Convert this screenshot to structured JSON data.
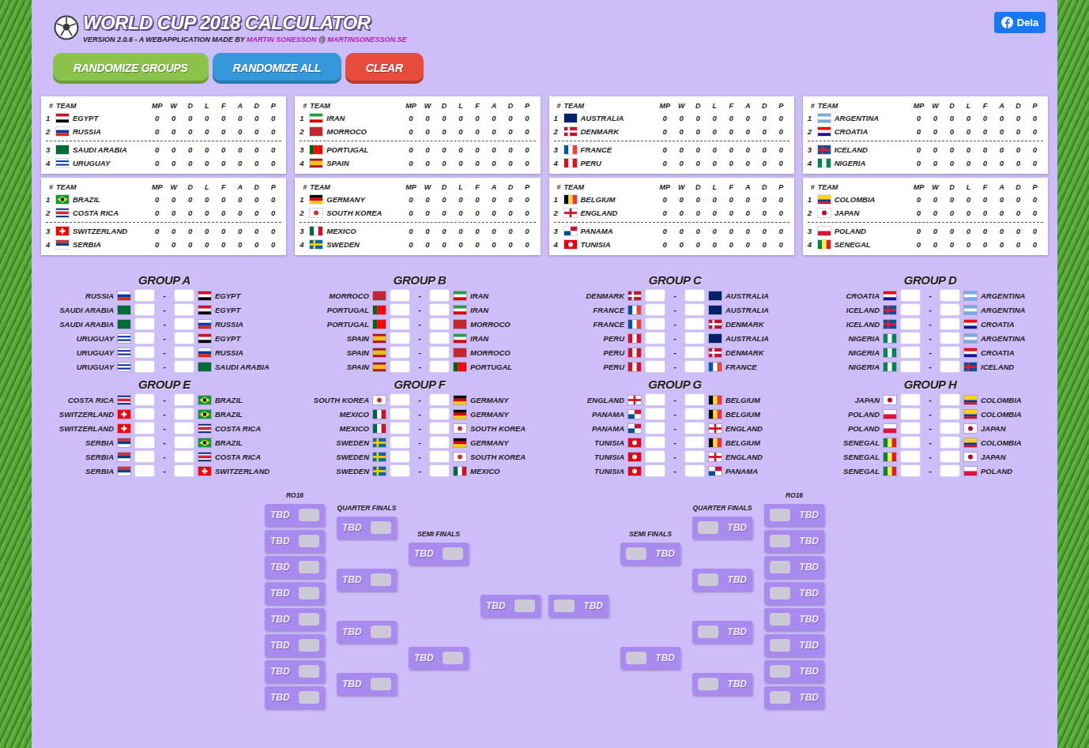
{
  "header": {
    "title": "WORLD CUP 2018 CALCULATOR",
    "version": "VERSION 2.0.6 - A WEBAPPLICATION MADE BY",
    "author": "MARTIN SONESSON",
    "at": "@",
    "site": "MARTINSONESSON.SE"
  },
  "share": {
    "label": "Dela"
  },
  "buttons": [
    {
      "label": "RANDOMIZE GROUPS",
      "color": "#8bc34a"
    },
    {
      "label": "RANDOMIZE ALL",
      "color": "#3498db"
    },
    {
      "label": "CLEAR",
      "color": "#e74c3c"
    }
  ],
  "tableColumns": [
    "#",
    "TEAM",
    "MP",
    "W",
    "D",
    "L",
    "F",
    "A",
    "D",
    "P"
  ],
  "tables": [
    {
      "rows": [
        {
          "pos": "1",
          "team": "EGYPT",
          "stats": [
            "0",
            "0",
            "0",
            "0",
            "0",
            "0",
            "0",
            "0"
          ]
        },
        {
          "pos": "2",
          "team": "RUSSIA",
          "stats": [
            "0",
            "0",
            "0",
            "0",
            "0",
            "0",
            "0",
            "0"
          ]
        },
        {
          "pos": "3",
          "team": "SAUDI ARABIA",
          "stats": [
            "0",
            "0",
            "0",
            "0",
            "0",
            "0",
            "0",
            "0"
          ]
        },
        {
          "pos": "4",
          "team": "URUGUAY",
          "stats": [
            "0",
            "0",
            "0",
            "0",
            "0",
            "0",
            "0",
            "0"
          ]
        }
      ]
    },
    {
      "rows": [
        {
          "pos": "1",
          "team": "IRAN",
          "stats": [
            "0",
            "0",
            "0",
            "0",
            "0",
            "0",
            "0",
            "0"
          ]
        },
        {
          "pos": "2",
          "team": "MORROCO",
          "stats": [
            "0",
            "0",
            "0",
            "0",
            "0",
            "0",
            "0",
            "0"
          ]
        },
        {
          "pos": "3",
          "team": "PORTUGAL",
          "stats": [
            "0",
            "0",
            "0",
            "0",
            "0",
            "0",
            "0",
            "0"
          ]
        },
        {
          "pos": "4",
          "team": "SPAIN",
          "stats": [
            "0",
            "0",
            "0",
            "0",
            "0",
            "0",
            "0",
            "0"
          ]
        }
      ]
    },
    {
      "rows": [
        {
          "pos": "1",
          "team": "AUSTRALIA",
          "stats": [
            "0",
            "0",
            "0",
            "0",
            "0",
            "0",
            "0",
            "0"
          ]
        },
        {
          "pos": "2",
          "team": "DENMARK",
          "stats": [
            "0",
            "0",
            "0",
            "0",
            "0",
            "0",
            "0",
            "0"
          ]
        },
        {
          "pos": "3",
          "team": "FRANCE",
          "stats": [
            "0",
            "0",
            "0",
            "0",
            "0",
            "0",
            "0",
            "0"
          ]
        },
        {
          "pos": "4",
          "team": "PERU",
          "stats": [
            "0",
            "0",
            "0",
            "0",
            "0",
            "0",
            "0",
            "0"
          ]
        }
      ]
    },
    {
      "rows": [
        {
          "pos": "1",
          "team": "ARGENTINA",
          "stats": [
            "0",
            "0",
            "0",
            "0",
            "0",
            "0",
            "0",
            "0"
          ]
        },
        {
          "pos": "2",
          "team": "CROATIA",
          "stats": [
            "0",
            "0",
            "0",
            "0",
            "0",
            "0",
            "0",
            "0"
          ]
        },
        {
          "pos": "3",
          "team": "ICELAND",
          "stats": [
            "0",
            "0",
            "0",
            "0",
            "0",
            "0",
            "0",
            "0"
          ]
        },
        {
          "pos": "4",
          "team": "NIGERIA",
          "stats": [
            "0",
            "0",
            "0",
            "0",
            "0",
            "0",
            "0",
            "0"
          ]
        }
      ]
    },
    {
      "rows": [
        {
          "pos": "1",
          "team": "BRAZIL",
          "stats": [
            "0",
            "0",
            "0",
            "0",
            "0",
            "0",
            "0",
            "0"
          ]
        },
        {
          "pos": "2",
          "team": "COSTA RICA",
          "stats": [
            "0",
            "0",
            "0",
            "0",
            "0",
            "0",
            "0",
            "0"
          ]
        },
        {
          "pos": "3",
          "team": "SWITZERLAND",
          "stats": [
            "0",
            "0",
            "0",
            "0",
            "0",
            "0",
            "0",
            "0"
          ]
        },
        {
          "pos": "4",
          "team": "SERBIA",
          "stats": [
            "0",
            "0",
            "0",
            "0",
            "0",
            "0",
            "0",
            "0"
          ]
        }
      ]
    },
    {
      "rows": [
        {
          "pos": "1",
          "team": "GERMANY",
          "stats": [
            "0",
            "0",
            "0",
            "0",
            "0",
            "0",
            "0",
            "0"
          ]
        },
        {
          "pos": "2",
          "team": "SOUTH KOREA",
          "stats": [
            "0",
            "0",
            "0",
            "0",
            "0",
            "0",
            "0",
            "0"
          ]
        },
        {
          "pos": "3",
          "team": "MEXICO",
          "stats": [
            "0",
            "0",
            "0",
            "0",
            "0",
            "0",
            "0",
            "0"
          ]
        },
        {
          "pos": "4",
          "team": "SWEDEN",
          "stats": [
            "0",
            "0",
            "0",
            "0",
            "0",
            "0",
            "0",
            "0"
          ]
        }
      ]
    },
    {
      "rows": [
        {
          "pos": "1",
          "team": "BELGIUM",
          "stats": [
            "0",
            "0",
            "0",
            "0",
            "0",
            "0",
            "0",
            "0"
          ]
        },
        {
          "pos": "2",
          "team": "ENGLAND",
          "stats": [
            "0",
            "0",
            "0",
            "0",
            "0",
            "0",
            "0",
            "0"
          ]
        },
        {
          "pos": "3",
          "team": "PANAMA",
          "stats": [
            "0",
            "0",
            "0",
            "0",
            "0",
            "0",
            "0",
            "0"
          ]
        },
        {
          "pos": "4",
          "team": "TUNISIA",
          "stats": [
            "0",
            "0",
            "0",
            "0",
            "0",
            "0",
            "0",
            "0"
          ]
        }
      ]
    },
    {
      "rows": [
        {
          "pos": "1",
          "team": "COLOMBIA",
          "stats": [
            "0",
            "0",
            "0",
            "0",
            "0",
            "0",
            "0",
            "0"
          ]
        },
        {
          "pos": "2",
          "team": "JAPAN",
          "stats": [
            "0",
            "0",
            "0",
            "0",
            "0",
            "0",
            "0",
            "0"
          ]
        },
        {
          "pos": "3",
          "team": "POLAND",
          "stats": [
            "0",
            "0",
            "0",
            "0",
            "0",
            "0",
            "0",
            "0"
          ]
        },
        {
          "pos": "4",
          "team": "SENEGAL",
          "stats": [
            "0",
            "0",
            "0",
            "0",
            "0",
            "0",
            "0",
            "0"
          ]
        }
      ]
    }
  ],
  "flags": {
    "EGYPT": {
      "kind": "h",
      "colors": [
        "#ce1126",
        "#ffffff",
        "#000000"
      ]
    },
    "RUSSIA": {
      "kind": "h",
      "colors": [
        "#ffffff",
        "#0039a6",
        "#d52b1e"
      ]
    },
    "SAUDI ARABIA": {
      "kind": "h",
      "colors": [
        "#006c35"
      ]
    },
    "URUGUAY": {
      "kind": "h",
      "colors": [
        "#ffffff",
        "#0038a8",
        "#ffffff",
        "#0038a8",
        "#ffffff"
      ]
    },
    "IRAN": {
      "kind": "h",
      "colors": [
        "#239f40",
        "#ffffff",
        "#da0000"
      ]
    },
    "MORROCO": {
      "kind": "h",
      "colors": [
        "#c1272d"
      ]
    },
    "PORTUGAL": {
      "kind": "v",
      "colors": [
        "#006600",
        "#ff0000",
        "#ff0000"
      ]
    },
    "SPAIN": {
      "kind": "h",
      "colors": [
        "#aa151b",
        "#f1bf00",
        "#f1bf00",
        "#aa151b"
      ]
    },
    "AUSTRALIA": {
      "kind": "h",
      "colors": [
        "#012169"
      ]
    },
    "DENMARK": {
      "kind": "cross",
      "colors": [
        "#c8102e",
        "#ffffff"
      ]
    },
    "FRANCE": {
      "kind": "v",
      "colors": [
        "#0055a4",
        "#ffffff",
        "#ef4135"
      ]
    },
    "PERU": {
      "kind": "v",
      "colors": [
        "#d91023",
        "#ffffff",
        "#d91023"
      ]
    },
    "ARGENTINA": {
      "kind": "h",
      "colors": [
        "#74acdf",
        "#ffffff",
        "#74acdf"
      ]
    },
    "CROATIA": {
      "kind": "h",
      "colors": [
        "#ff0000",
        "#ffffff",
        "#171796"
      ]
    },
    "ICELAND": {
      "kind": "cross",
      "colors": [
        "#02529c",
        "#dc1e35"
      ]
    },
    "NIGERIA": {
      "kind": "v",
      "colors": [
        "#008751",
        "#ffffff",
        "#008751"
      ]
    },
    "BRAZIL": {
      "kind": "diamond",
      "colors": [
        "#009c3b",
        "#ffdf00",
        "#002776"
      ]
    },
    "COSTA RICA": {
      "kind": "h",
      "colors": [
        "#002b7f",
        "#ffffff",
        "#ce1126",
        "#ce1126",
        "#ffffff",
        "#002b7f"
      ]
    },
    "SWITZERLAND": {
      "kind": "swiss",
      "colors": [
        "#ff0000",
        "#ffffff"
      ]
    },
    "SERBIA": {
      "kind": "h",
      "colors": [
        "#c6363c",
        "#0c4076",
        "#ffffff"
      ]
    },
    "GERMANY": {
      "kind": "h",
      "colors": [
        "#000000",
        "#dd0000",
        "#ffce00"
      ]
    },
    "SOUTH KOREA": {
      "kind": "disc",
      "colors": [
        "#ffffff",
        "#cd2e3a"
      ]
    },
    "MEXICO": {
      "kind": "v",
      "colors": [
        "#006847",
        "#ffffff",
        "#ce1126"
      ]
    },
    "SWEDEN": {
      "kind": "cross",
      "colors": [
        "#006aa7",
        "#fecc00"
      ]
    },
    "BELGIUM": {
      "kind": "v",
      "colors": [
        "#000000",
        "#fdda24",
        "#ef3340"
      ]
    },
    "ENGLAND": {
      "kind": "plus",
      "colors": [
        "#ffffff",
        "#ce1124"
      ]
    },
    "PANAMA": {
      "kind": "quarters",
      "colors": [
        "#ffffff",
        "#d21034",
        "#005293",
        "#ffffff"
      ]
    },
    "TUNISIA": {
      "kind": "disc",
      "colors": [
        "#e70013",
        "#ffffff"
      ]
    },
    "COLOMBIA": {
      "kind": "h",
      "colors": [
        "#fcd116",
        "#fcd116",
        "#003893",
        "#ce1126"
      ]
    },
    "JAPAN": {
      "kind": "disc",
      "colors": [
        "#ffffff",
        "#bc002d"
      ]
    },
    "POLAND": {
      "kind": "h",
      "colors": [
        "#ffffff",
        "#dc143c"
      ]
    },
    "SENEGAL": {
      "kind": "v",
      "colors": [
        "#00853f",
        "#fdef42",
        "#e31b23"
      ]
    }
  },
  "scoreSeparator": "-",
  "groups": [
    {
      "title": "GROUP A",
      "matches": [
        {
          "home": "RUSSIA",
          "away": "EGYPT"
        },
        {
          "home": "SAUDI ARABIA",
          "away": "EGYPT"
        },
        {
          "home": "SAUDI ARABIA",
          "away": "RUSSIA"
        },
        {
          "home": "URUGUAY",
          "away": "EGYPT"
        },
        {
          "home": "URUGUAY",
          "away": "RUSSIA"
        },
        {
          "home": "URUGUAY",
          "away": "SAUDI ARABIA"
        }
      ]
    },
    {
      "title": "GROUP B",
      "matches": [
        {
          "home": "MORROCO",
          "away": "IRAN"
        },
        {
          "home": "PORTUGAL",
          "away": "IRAN"
        },
        {
          "home": "PORTUGAL",
          "away": "MORROCO"
        },
        {
          "home": "SPAIN",
          "away": "IRAN"
        },
        {
          "home": "SPAIN",
          "away": "MORROCO"
        },
        {
          "home": "SPAIN",
          "away": "PORTUGAL"
        }
      ]
    },
    {
      "title": "GROUP C",
      "matches": [
        {
          "home": "DENMARK",
          "away": "AUSTRALIA"
        },
        {
          "home": "FRANCE",
          "away": "AUSTRALIA"
        },
        {
          "home": "FRANCE",
          "away": "DENMARK"
        },
        {
          "home": "PERU",
          "away": "AUSTRALIA"
        },
        {
          "home": "PERU",
          "away": "DENMARK"
        },
        {
          "home": "PERU",
          "away": "FRANCE"
        }
      ]
    },
    {
      "title": "GROUP D",
      "matches": [
        {
          "home": "CROATIA",
          "away": "ARGENTINA"
        },
        {
          "home": "ICELAND",
          "away": "ARGENTINA"
        },
        {
          "home": "ICELAND",
          "away": "CROATIA"
        },
        {
          "home": "NIGERIA",
          "away": "ARGENTINA"
        },
        {
          "home": "NIGERIA",
          "away": "CROATIA"
        },
        {
          "home": "NIGERIA",
          "away": "ICELAND"
        }
      ]
    },
    {
      "title": "GROUP E",
      "matches": [
        {
          "home": "COSTA RICA",
          "away": "BRAZIL"
        },
        {
          "home": "SWITZERLAND",
          "away": "BRAZIL"
        },
        {
          "home": "SWITZERLAND",
          "away": "COSTA RICA"
        },
        {
          "home": "SERBIA",
          "away": "BRAZIL"
        },
        {
          "home": "SERBIA",
          "away": "COSTA RICA"
        },
        {
          "home": "SERBIA",
          "away": "SWITZERLAND"
        }
      ]
    },
    {
      "title": "GROUP F",
      "matches": [
        {
          "home": "SOUTH KOREA",
          "away": "GERMANY"
        },
        {
          "home": "MEXICO",
          "away": "GERMANY"
        },
        {
          "home": "MEXICO",
          "away": "SOUTH KOREA"
        },
        {
          "home": "SWEDEN",
          "away": "GERMANY"
        },
        {
          "home": "SWEDEN",
          "away": "SOUTH KOREA"
        },
        {
          "home": "SWEDEN",
          "away": "MEXICO"
        }
      ]
    },
    {
      "title": "GROUP G",
      "matches": [
        {
          "home": "ENGLAND",
          "away": "BELGIUM"
        },
        {
          "home": "PANAMA",
          "away": "BELGIUM"
        },
        {
          "home": "PANAMA",
          "away": "ENGLAND"
        },
        {
          "home": "TUNISIA",
          "away": "BELGIUM"
        },
        {
          "home": "TUNISIA",
          "away": "ENGLAND"
        },
        {
          "home": "TUNISIA",
          "away": "PANAMA"
        }
      ]
    },
    {
      "title": "GROUP H",
      "matches": [
        {
          "home": "JAPAN",
          "away": "COLOMBIA"
        },
        {
          "home": "POLAND",
          "away": "COLOMBIA"
        },
        {
          "home": "POLAND",
          "away": "JAPAN"
        },
        {
          "home": "SENEGAL",
          "away": "COLOMBIA"
        },
        {
          "home": "SENEGAL",
          "away": "JAPAN"
        },
        {
          "home": "SENEGAL",
          "away": "POLAND"
        }
      ]
    }
  ],
  "bracket": {
    "left": [
      {
        "label": "RO16",
        "slots": [
          "TBD",
          "TBD",
          "TBD",
          "TBD",
          "TBD",
          "TBD",
          "TBD",
          "TBD"
        ]
      },
      {
        "label": "QUARTER FINALS",
        "slots": [
          "TBD",
          "TBD",
          "TBD",
          "TBD"
        ]
      },
      {
        "label": "SEMI FINALS",
        "slots": [
          "TBD",
          "TBD"
        ]
      },
      {
        "slots": [
          "TBD"
        ]
      }
    ],
    "right": [
      {
        "slots": [
          "TBD"
        ]
      },
      {
        "label": "SEMI FINALS",
        "slots": [
          "TBD",
          "TBD"
        ]
      },
      {
        "label": "QUARTER FINALS",
        "slots": [
          "TBD",
          "TBD",
          "TBD",
          "TBD"
        ]
      },
      {
        "label": "RO16",
        "slots": [
          "TBD",
          "TBD",
          "TBD",
          "TBD",
          "TBD",
          "TBD",
          "TBD",
          "TBD"
        ]
      }
    ]
  }
}
